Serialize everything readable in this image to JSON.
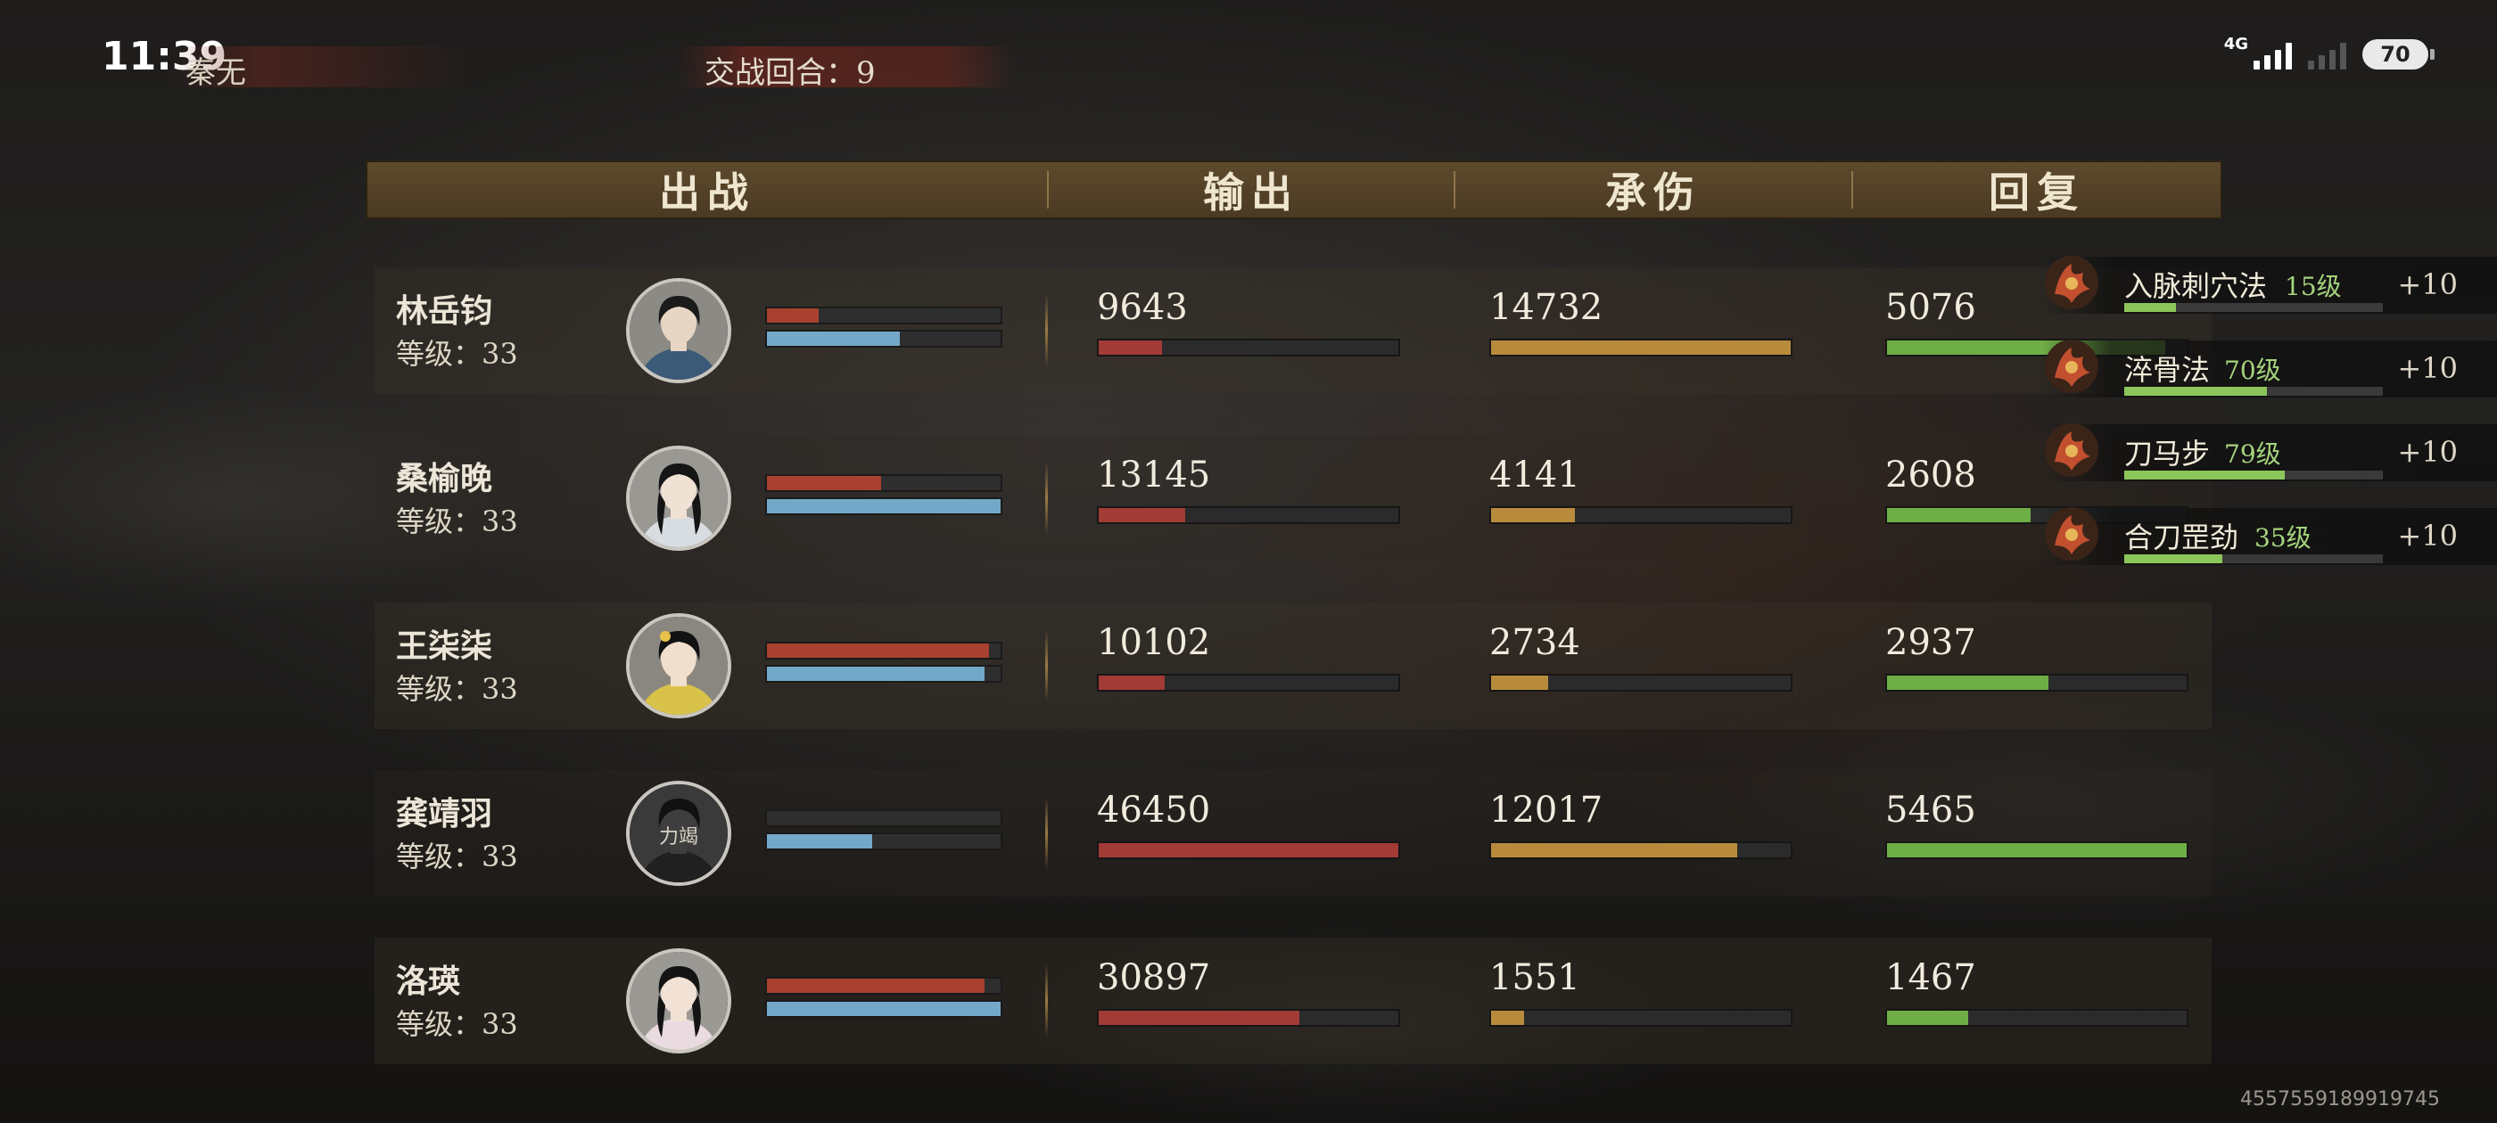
{
  "status_bar": {
    "time": "11:39",
    "network": "4G",
    "battery": "70"
  },
  "top": {
    "player_name": "秦无",
    "round_label": "交战回合：9"
  },
  "header": {
    "col_deploy": "出战",
    "col_output": "输出",
    "col_damage_taken": "承伤",
    "col_heal": "回复"
  },
  "rows": [
    {
      "name": "林岳钧",
      "level": "等级：33",
      "hp_fill": 0.22,
      "mp_fill": 0.57,
      "output": "9643",
      "output_fill": 0.21,
      "taken": "14732",
      "taken_fill": 1.0,
      "heal": "5076",
      "heal_fill": 0.93
    },
    {
      "name": "桑榆晚",
      "level": "等级：33",
      "hp_fill": 0.49,
      "mp_fill": 1.0,
      "output": "13145",
      "output_fill": 0.29,
      "taken": "4141",
      "taken_fill": 0.28,
      "heal": "2608",
      "heal_fill": 0.48
    },
    {
      "name": "王柒柒",
      "level": "等级：33",
      "hp_fill": 0.95,
      "mp_fill": 0.93,
      "output": "10102",
      "output_fill": 0.22,
      "taken": "2734",
      "taken_fill": 0.19,
      "heal": "2937",
      "heal_fill": 0.54
    },
    {
      "name": "龚靖羽",
      "level": "等级：33",
      "hp_fill": 0.0,
      "mp_fill": 0.45,
      "output": "46450",
      "output_fill": 1.0,
      "taken": "12017",
      "taken_fill": 0.82,
      "heal": "5465",
      "heal_fill": 1.0,
      "avatar_text": "力竭"
    },
    {
      "name": "洛瑛",
      "level": "等级：33",
      "hp_fill": 0.93,
      "mp_fill": 1.0,
      "output": "30897",
      "output_fill": 0.67,
      "taken": "1551",
      "taken_fill": 0.11,
      "heal": "1467",
      "heal_fill": 0.27
    }
  ],
  "skills": [
    {
      "name": "入脉刺穴法",
      "level": "15级",
      "gain": "+10",
      "progress": 0.2
    },
    {
      "name": "淬骨法",
      "level": "70级",
      "gain": "+10",
      "progress": 0.55
    },
    {
      "name": "刀马步",
      "level": "79级",
      "gain": "+10",
      "progress": 0.62
    },
    {
      "name": "合刀罡劲",
      "level": "35级",
      "gain": "+10",
      "progress": 0.38
    }
  ],
  "uid": "4557559189919745"
}
